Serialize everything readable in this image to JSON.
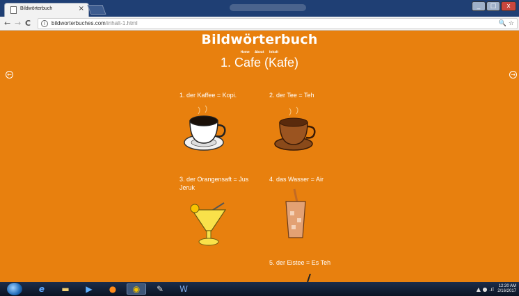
{
  "browser": {
    "tab_title": "Bildwörterbuch",
    "tab_close": "×",
    "url_domain": "bildworterbuches.com",
    "url_path": "/inhalt-1.html",
    "back": "←",
    "forward": "→",
    "reload": "C",
    "info": "i",
    "omni_icons": "🔍 ☆"
  },
  "page": {
    "brand": "Bildwörterbuch",
    "menu": [
      "Home",
      "About",
      "Inhalt"
    ],
    "title": "1. Cafe (Kafe)",
    "prev_arrow": "←",
    "next_arrow": "→"
  },
  "items": [
    {
      "label": "1. der Kaffee = Kopi."
    },
    {
      "label": "2. der Tee = Teh"
    },
    {
      "label": "3. der Orangensaft = Jus Jeruk"
    },
    {
      "label": "4. das Wasser = Air"
    },
    {
      "label": "5. der Eistee = Es Teh"
    }
  ],
  "taskbar": {
    "time": "12:20 AM",
    "date": "2/16/2017"
  }
}
